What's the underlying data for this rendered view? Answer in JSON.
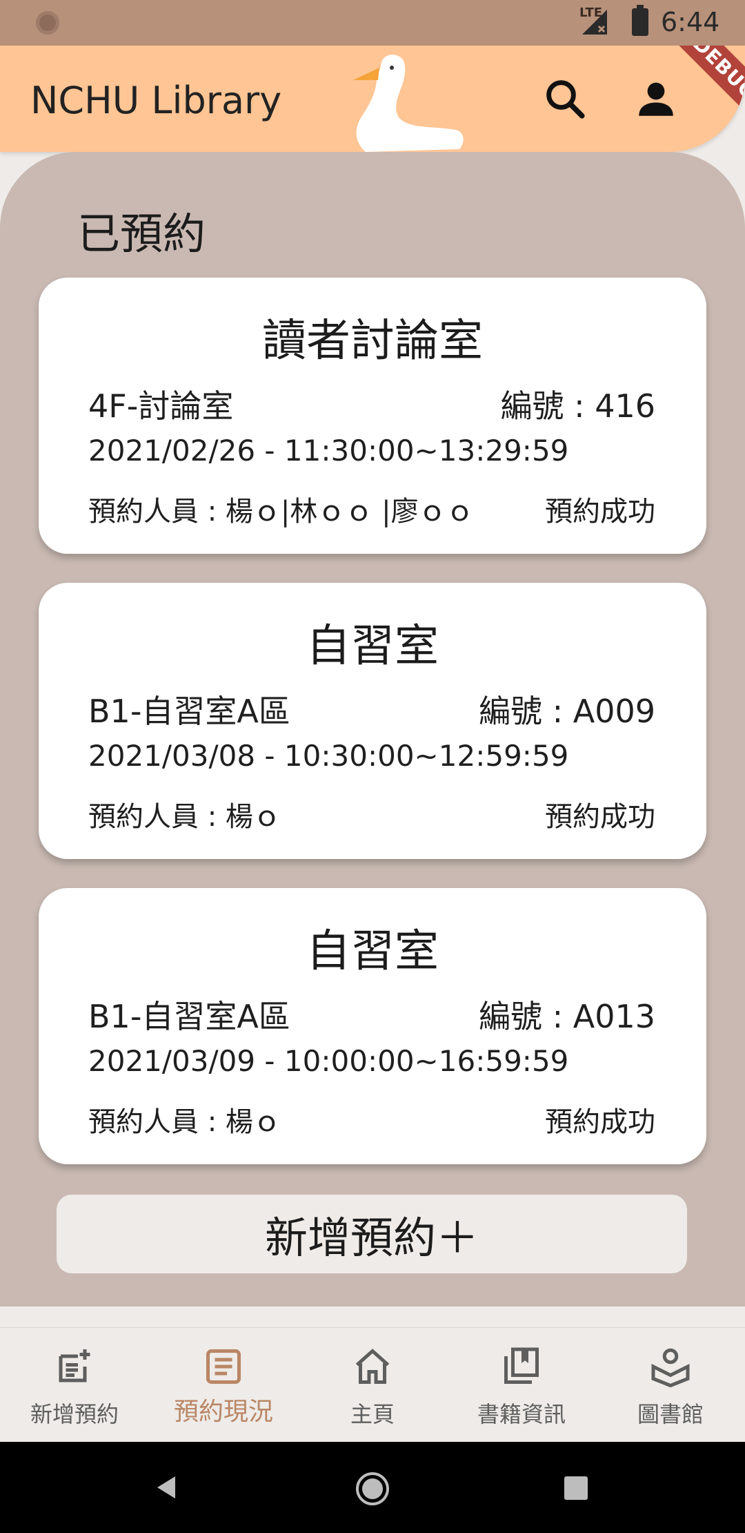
{
  "status_bar": {
    "network": "LTE",
    "time": "6:44",
    "debug_label": "DEBUG"
  },
  "app_bar": {
    "title": "NCHU Library",
    "search_icon": "search-icon",
    "account_icon": "person-icon",
    "color": "#FFC594"
  },
  "main": {
    "section_title": "已預約",
    "reservations": [
      {
        "title": "讀者討論室",
        "location": "4F-討論室",
        "number": "編號 : 416",
        "datetime": "2021/02/26  -  11:30:00~13:29:59",
        "members": "預約人員 : 楊ｏ|林ｏｏ |廖ｏｏ",
        "status": "預約成功"
      },
      {
        "title": "自習室",
        "location": "B1-自習室A區",
        "number": "編號 : A009",
        "datetime": "2021/03/08  -  10:30:00~12:59:59",
        "members": "預約人員 : 楊ｏ",
        "status": "預約成功"
      },
      {
        "title": "自習室",
        "location": "B1-自習室A區",
        "number": "編號 : A013",
        "datetime": "2021/03/09  -  10:00:00~16:59:59",
        "members": "預約人員 : 楊ｏ",
        "status": "預約成功"
      }
    ],
    "add_button": "新增預約＋"
  },
  "bottom_nav": {
    "items": [
      {
        "label": "新增預約",
        "icon": "add-note-icon",
        "active": false
      },
      {
        "label": "預約現況",
        "icon": "article-icon",
        "active": true
      },
      {
        "label": "主頁",
        "icon": "home-icon",
        "active": false
      },
      {
        "label": "書籍資訊",
        "icon": "bookmarks-icon",
        "active": false
      },
      {
        "label": "圖書館",
        "icon": "library-icon",
        "active": false
      }
    ],
    "active_color": "#B98665"
  }
}
